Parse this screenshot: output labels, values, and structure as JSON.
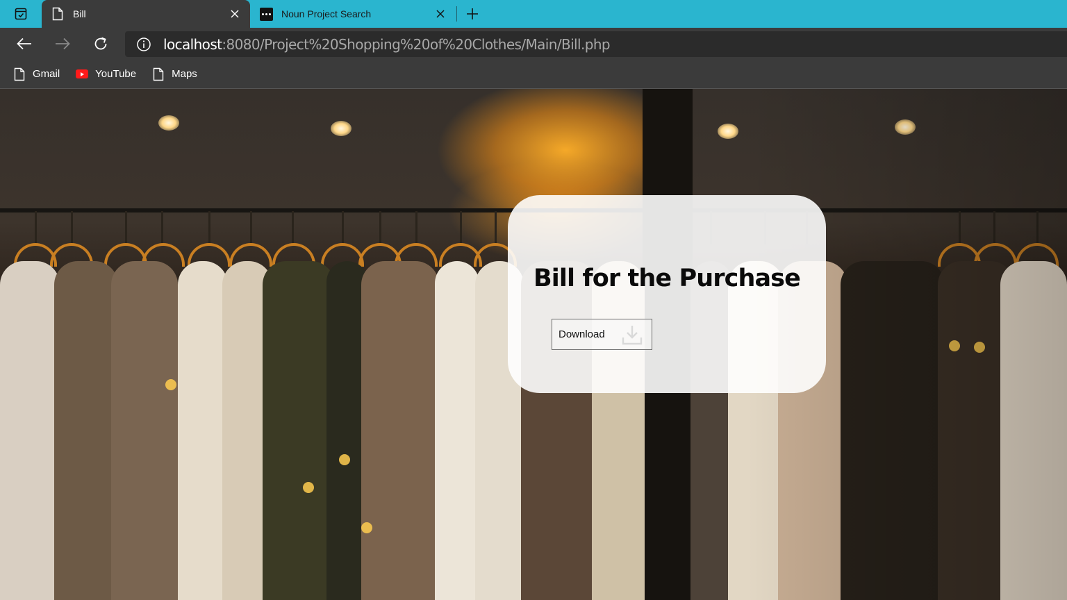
{
  "tabs": [
    {
      "title": "Bill",
      "favicon": "page-icon",
      "active": true
    },
    {
      "title": "Noun Project Search",
      "favicon": "noun-project-icon",
      "active": false
    }
  ],
  "address_bar": {
    "host": "localhost",
    "path": ":8080/Project%20Shopping%20of%20Clothes/Main/Bill.php",
    "icon": "info-icon"
  },
  "bookmarks": [
    {
      "label": "Gmail",
      "icon": "page-icon"
    },
    {
      "label": "YouTube",
      "icon": "youtube-icon"
    },
    {
      "label": "Maps",
      "icon": "page-icon"
    }
  ],
  "card": {
    "title": "Bill for the Purchase",
    "download_label": "Download",
    "download_icon": "download-icon"
  },
  "colors": {
    "tab_strip": "#2ab5cf",
    "toolbar": "#3b3b3b",
    "omnibox": "#2b2b2b",
    "card_background": "#ffffff"
  }
}
